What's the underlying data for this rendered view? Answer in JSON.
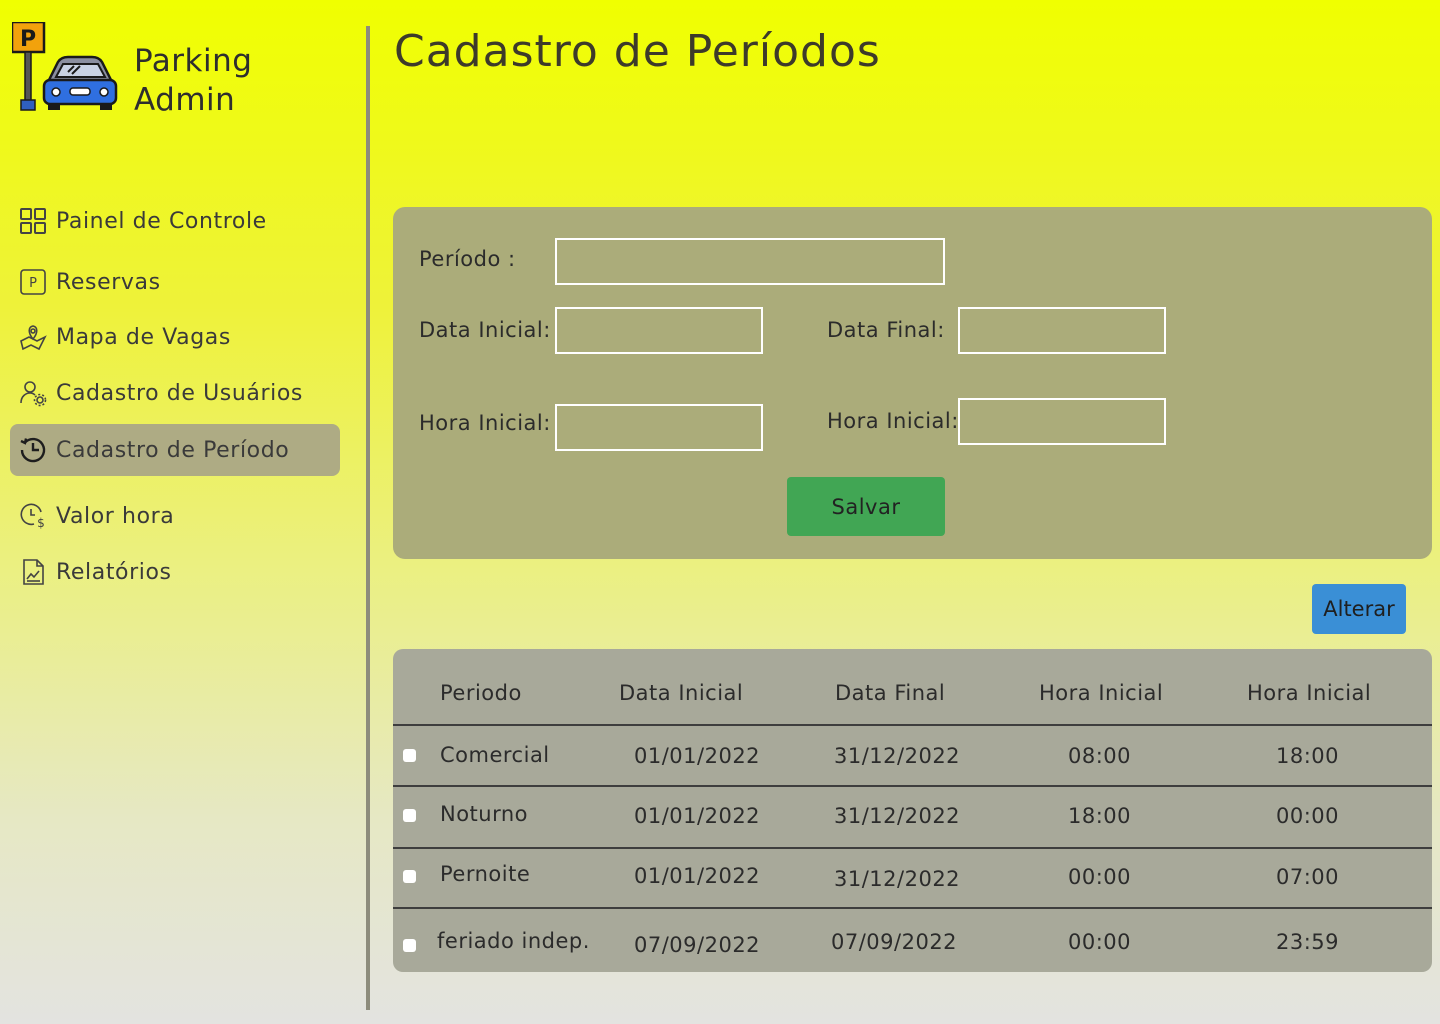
{
  "app": {
    "name_line1": "Parking",
    "name_line2": "Admin",
    "logo_sign_letter": "P"
  },
  "sidebar": {
    "items": [
      {
        "label": "Painel de Controle",
        "icon": "dashboard-grid-icon"
      },
      {
        "label": "Reservas",
        "icon": "parking-p-icon"
      },
      {
        "label": "Mapa de Vagas",
        "icon": "map-pin-icon"
      },
      {
        "label": "Cadastro de Usuários",
        "icon": "user-gear-icon"
      },
      {
        "label": "Cadastro de Período",
        "icon": "history-clock-icon",
        "active": true
      },
      {
        "label": "Valor hora",
        "icon": "clock-dollar-icon"
      },
      {
        "label": "Relatórios",
        "icon": "report-document-icon"
      }
    ]
  },
  "main": {
    "title": "Cadastro de Períodos"
  },
  "form": {
    "periodo_label": "Período :",
    "data_inicial_label": "Data Inicial:",
    "data_final_label": "Data Final:",
    "hora_inicial_label": "Hora Inicial:",
    "hora_inicial2_label": "Hora Inicial:",
    "periodo_value": "",
    "data_inicial_value": "",
    "data_final_value": "",
    "hora_inicial_value": "",
    "hora_inicial2_value": "",
    "save_label": "Salvar"
  },
  "actions": {
    "alter_label": "Alterar"
  },
  "table": {
    "headers": [
      "Periodo",
      "Data Inicial",
      "Data Final",
      "Hora Inicial",
      "Hora Inicial"
    ],
    "rows": [
      {
        "periodo": "Comercial",
        "data_inicial": "01/01/2022",
        "data_final": "31/12/2022",
        "hora_inicial": "08:00",
        "hora_final": "18:00"
      },
      {
        "periodo": "Noturno",
        "data_inicial": "01/01/2022",
        "data_final": "31/12/2022",
        "hora_inicial": "18:00",
        "hora_final": "00:00"
      },
      {
        "periodo": "Pernoite",
        "data_inicial": "01/01/2022",
        "data_final": "31/12/2022",
        "hora_inicial": "00:00",
        "hora_final": "07:00"
      },
      {
        "periodo": "feriado indep.",
        "data_inicial": "07/09/2022",
        "data_final": "07/09/2022",
        "hora_inicial": "00:00",
        "hora_final": "23:59"
      }
    ]
  },
  "colors": {
    "form_card": "#abac7a",
    "table_card": "#a8a99a",
    "save_button": "#41a654",
    "alter_button": "#3a8fd6",
    "active_nav": "#aeab84"
  }
}
